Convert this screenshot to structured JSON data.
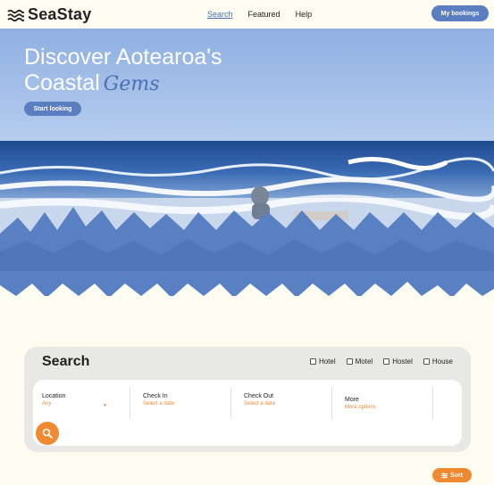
{
  "brand": {
    "name": "SeaStay",
    "icon": "waves-icon"
  },
  "nav": {
    "search": "Search",
    "featured": "Featured",
    "help": "Help"
  },
  "header": {
    "bookings_label": "My bookings"
  },
  "hero": {
    "title_line1": "Discover Aotearoa's",
    "title_line2": "Coastal",
    "title_accent": "Gems",
    "cta_label": "Start looking"
  },
  "search": {
    "title": "Search",
    "types": [
      "Hotel",
      "Motel",
      "Hostel",
      "House"
    ],
    "location_label": "Location",
    "location_value": "Any",
    "checkin_label": "Check In",
    "checkin_placeholder": "Select a date",
    "checkout_label": "Check Out",
    "checkout_placeholder": "Select a date",
    "more_label": "More",
    "more_value": "More options",
    "button_icon": "search-icon"
  },
  "sort": {
    "label": "Sort",
    "icon": "sliders-icon"
  },
  "colors": {
    "accent_blue": "#5b7ec1",
    "accent_orange": "#ef8a33",
    "background": "#fdfcf0"
  }
}
